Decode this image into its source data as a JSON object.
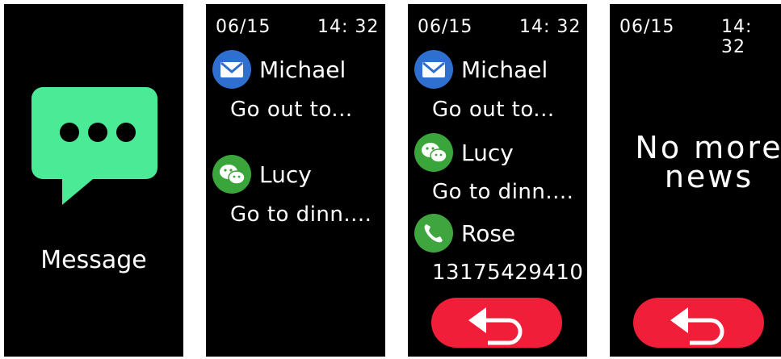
{
  "screen1": {
    "app_icon": "message-bubble-icon",
    "label": "Message"
  },
  "status_bar": {
    "date": "06/15",
    "time": "14: 32"
  },
  "screen2": {
    "notifications": [
      {
        "icon": "email-icon",
        "sender": "Michael",
        "text": "Go out to..."
      },
      {
        "icon": "wechat-icon",
        "sender": "Lucy",
        "text": "Go to dinn...."
      }
    ]
  },
  "screen3": {
    "notifications": [
      {
        "icon": "email-icon",
        "sender": "Michael",
        "text": "Go out to..."
      },
      {
        "icon": "wechat-icon",
        "sender": "Lucy",
        "text": "Go to dinn...."
      },
      {
        "icon": "phone-icon",
        "sender": "Rose",
        "text": "13175429410"
      }
    ],
    "back_icon": "back-arrow-icon"
  },
  "screen4": {
    "empty_line1": "No more",
    "empty_line2": "news",
    "back_icon": "back-arrow-icon"
  },
  "colors": {
    "accent_green": "#4bea96",
    "back_red": "#f01e38",
    "email_blue": "#2f6fd0",
    "wechat_green": "#3aa53a",
    "phone_green": "#3fa53f"
  }
}
